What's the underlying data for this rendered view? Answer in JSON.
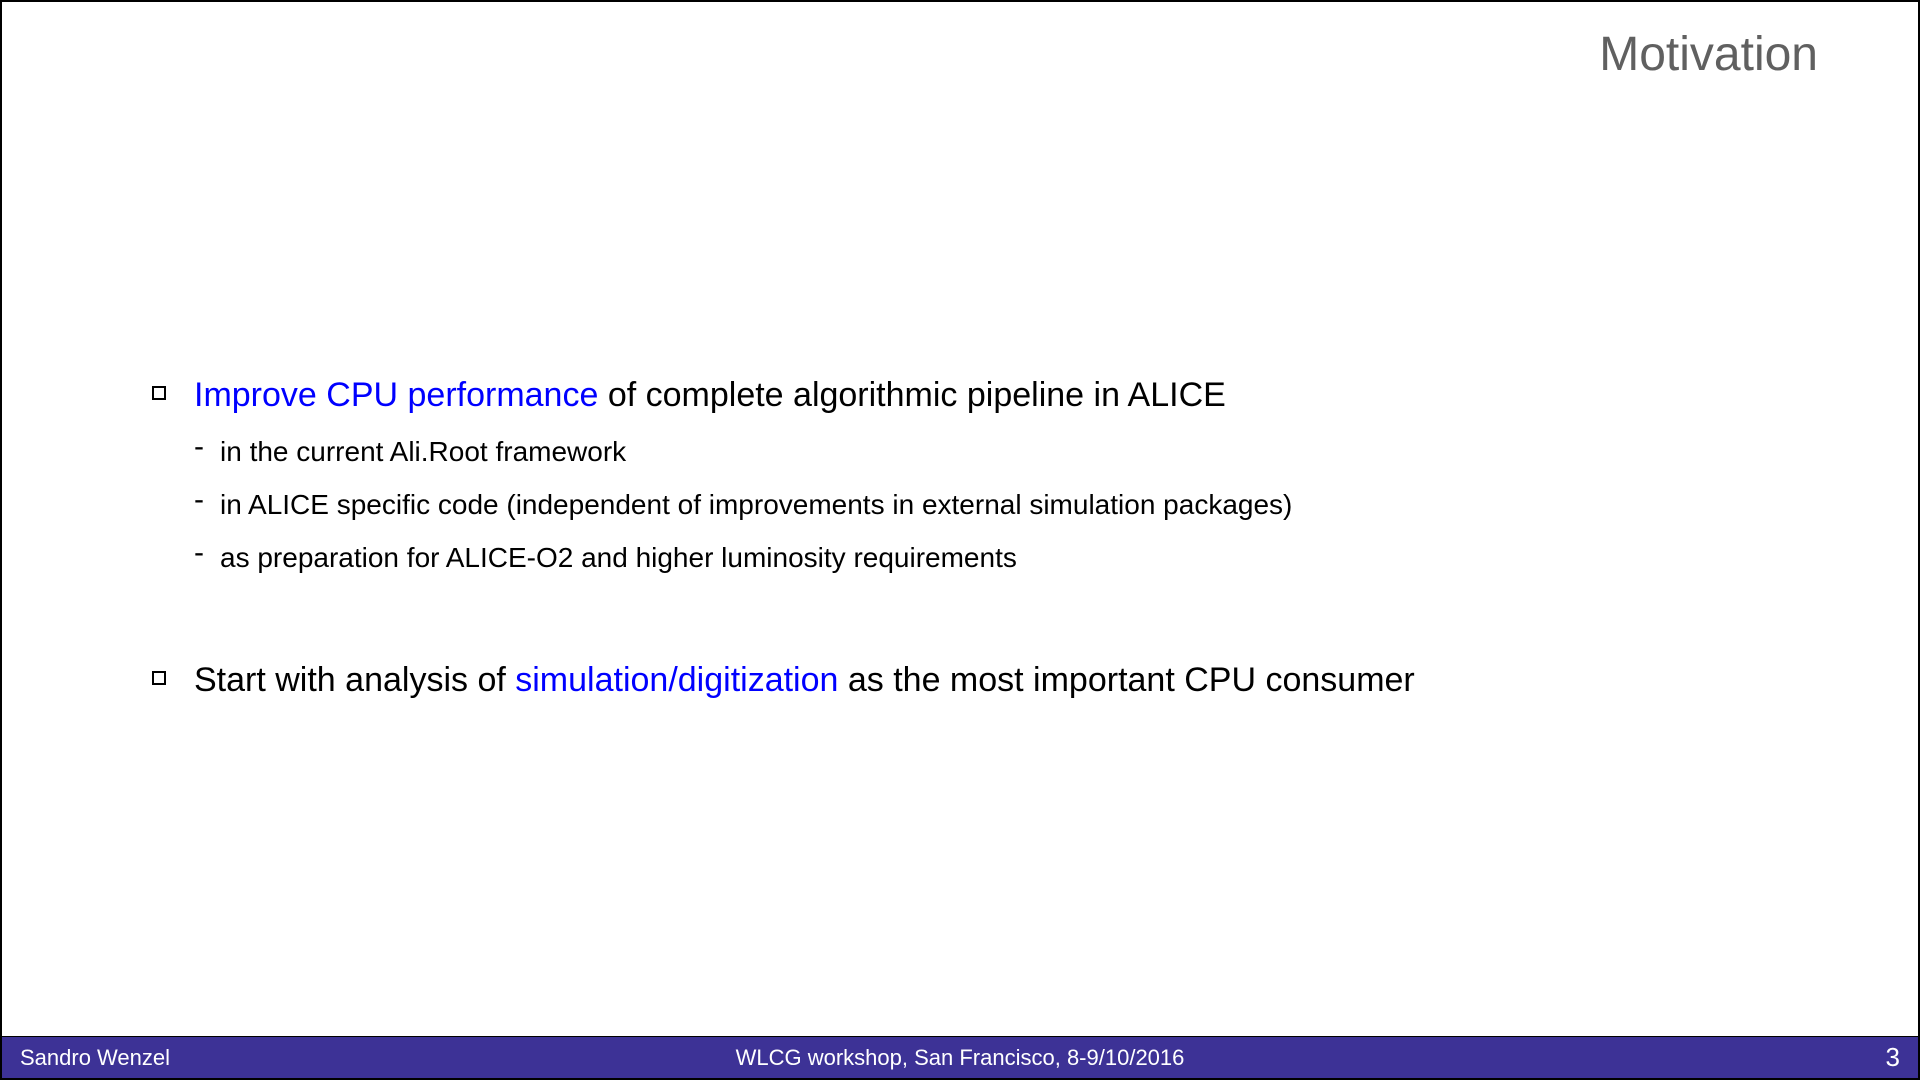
{
  "title": "Motivation",
  "bullet1": {
    "highlight": "Improve CPU performance",
    "rest": " of complete algorithmic pipeline in ALICE"
  },
  "sub1": "in the current Ali.Root framework",
  "sub2": "in ALICE specific code (independent of improvements in external simulation packages)",
  "sub3": "as preparation for ALICE-O2 and higher luminosity requirements",
  "bullet2": {
    "start": "Start with analysis of ",
    "highlight": "simulation/digitization",
    "rest": " as the most important CPU consumer"
  },
  "footer": {
    "author": "Sandro Wenzel",
    "event": "WLCG workshop,  San Francisco, 8-9/10/2016",
    "page": "3"
  }
}
